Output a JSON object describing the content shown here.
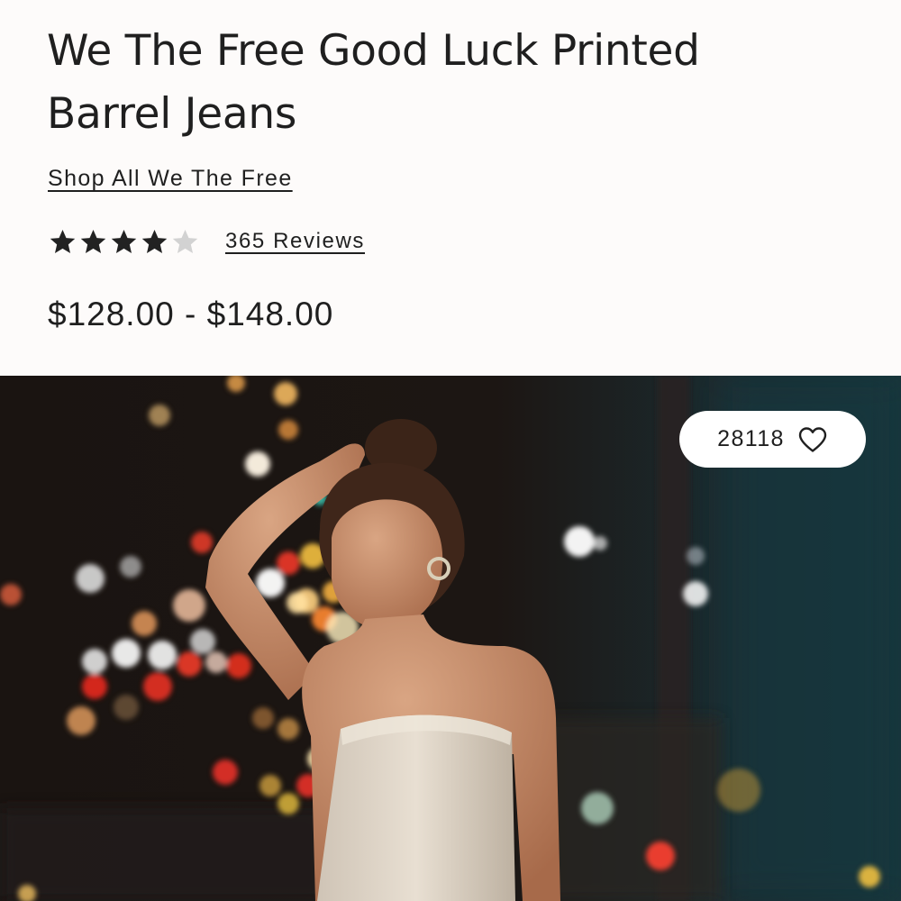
{
  "product": {
    "title": "We The Free Good Luck Printed Barrel Jeans",
    "brand_link": "Shop All We The Free",
    "rating": {
      "value": 4,
      "max": 5,
      "filled_color": "#222222",
      "empty_color": "#d2d2d2",
      "icon": "star-icon"
    },
    "reviews_link": "365 Reviews",
    "price": "$128.00 - $148.00"
  },
  "hero": {
    "favorite_count": "28118",
    "favorite_icon": "heart-outline-icon"
  }
}
